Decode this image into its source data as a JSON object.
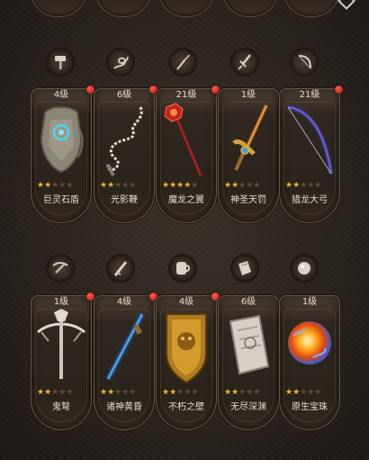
{
  "rows": [
    {
      "items": [
        {
          "level": "4级",
          "name": "巨灵石盾",
          "stars": 2,
          "red_dot": true,
          "icon": "hammer-icon",
          "art": "shield-art"
        },
        {
          "level": "6级",
          "name": "光影鞭",
          "stars": 2,
          "red_dot": true,
          "icon": "whip-icon",
          "art": "whip-art"
        },
        {
          "level": "21级",
          "name": "魔龙之翼",
          "stars": 4,
          "red_dot": true,
          "icon": "flail-icon",
          "art": "staff-art"
        },
        {
          "level": "1级",
          "name": "神圣天罚",
          "stars": 2,
          "red_dot": false,
          "icon": "sword-icon",
          "art": "sword-art"
        },
        {
          "level": "21级",
          "name": "猎龙大弓",
          "stars": 2,
          "red_dot": true,
          "icon": "bow-icon",
          "art": "bow-art"
        }
      ]
    },
    {
      "items": [
        {
          "level": "1级",
          "name": "鬼弩",
          "stars": 2,
          "red_dot": true,
          "icon": "crossbow-icon",
          "art": "crossbow-art"
        },
        {
          "level": "4级",
          "name": "诸神黄昏",
          "stars": 2,
          "red_dot": true,
          "icon": "gun-icon",
          "art": "gun-art"
        },
        {
          "level": "4级",
          "name": "不朽之壁",
          "stars": 2,
          "red_dot": true,
          "icon": "mug-icon",
          "art": "tower-shield-art"
        },
        {
          "level": "6级",
          "name": "无尽深渊",
          "stars": 2,
          "red_dot": false,
          "icon": "book-icon",
          "art": "tome-art"
        },
        {
          "level": "1级",
          "name": "原生宝珠",
          "stars": 2,
          "red_dot": false,
          "icon": "orb-icon",
          "art": "orb-art"
        }
      ]
    }
  ],
  "colors": {
    "star_on": "#f0b42a",
    "star_off": "#5b4c3d",
    "red_dot": "#d8261c",
    "text": "#e6dccd"
  }
}
